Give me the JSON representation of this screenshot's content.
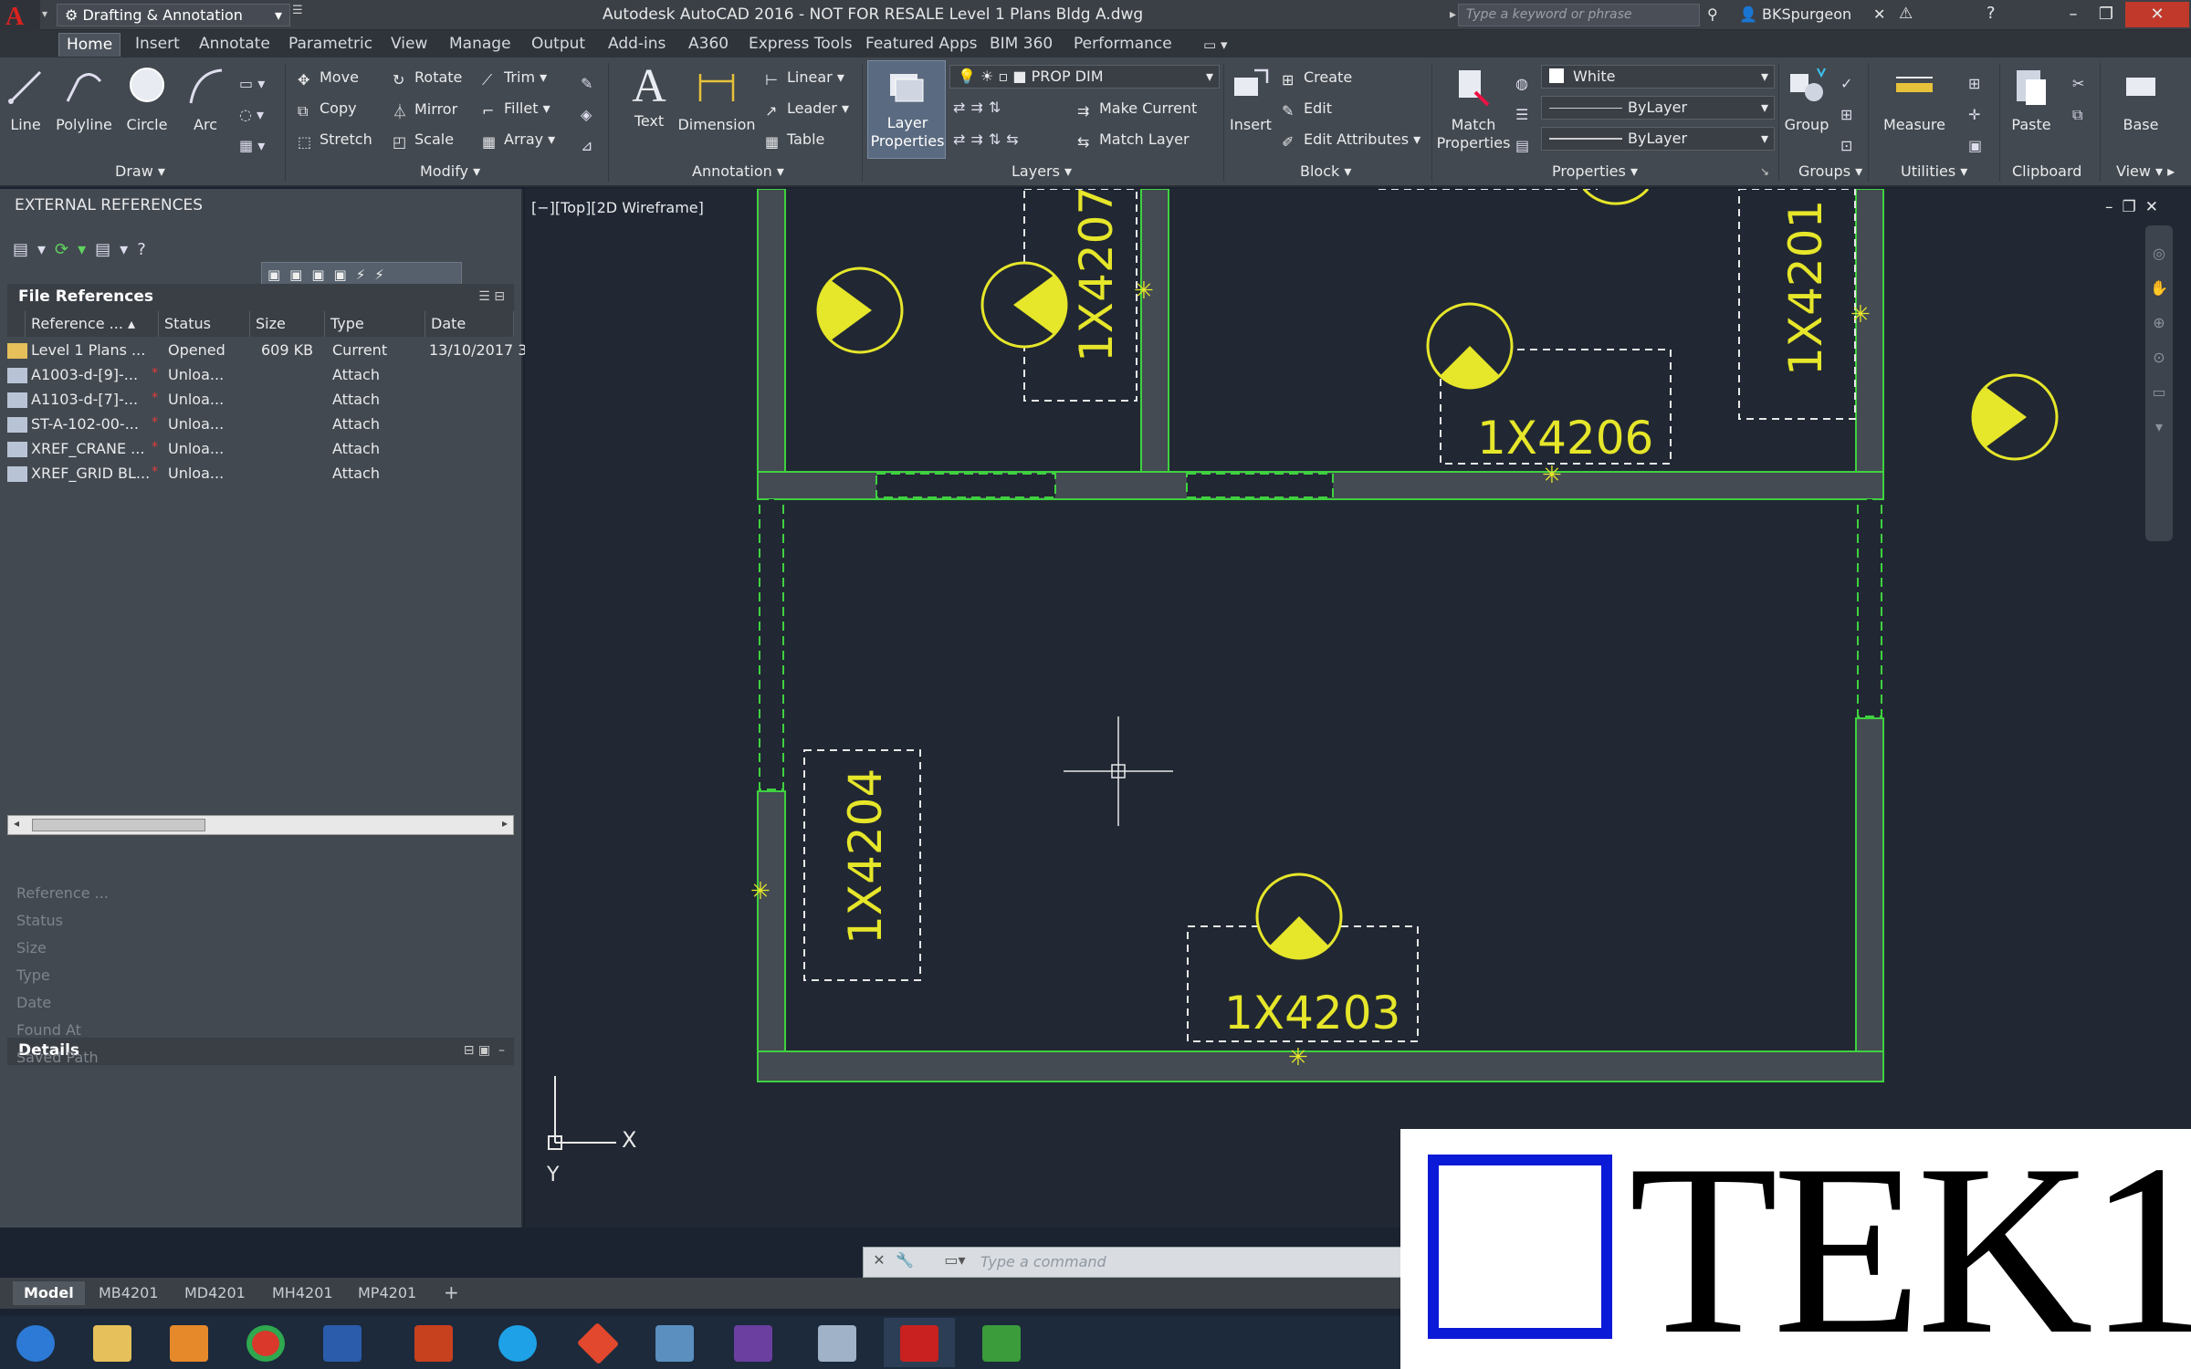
{
  "titlebar": {
    "title": "Autodesk AutoCAD 2016 - NOT FOR RESALE   Level 1 Plans Bldg A.dwg",
    "workspace": "Drafting & Annotation",
    "search_placeholder": "Type a keyword or phrase",
    "user": "BKSpurgeon"
  },
  "ribbon_tabs": [
    "Home",
    "Insert",
    "Annotate",
    "Parametric",
    "View",
    "Manage",
    "Output",
    "Add-ins",
    "A360",
    "Express Tools",
    "Featured Apps",
    "BIM 360",
    "Performance"
  ],
  "ribbon": {
    "draw": {
      "line": "Line",
      "polyline": "Polyline",
      "circle": "Circle",
      "arc": "Arc",
      "label": "Draw"
    },
    "modify": {
      "move": "Move",
      "rotate": "Rotate",
      "trim": "Trim",
      "copy": "Copy",
      "mirror": "Mirror",
      "fillet": "Fillet",
      "stretch": "Stretch",
      "scale": "Scale",
      "array": "Array",
      "label": "Modify"
    },
    "annotation": {
      "text": "Text",
      "dimension": "Dimension",
      "linear": "Linear",
      "leader": "Leader",
      "table": "Table",
      "label": "Annotation"
    },
    "layers": {
      "layer_properties_1": "Layer",
      "layer_properties_2": "Properties",
      "current_layer": "PROP DIM",
      "make_current": "Make Current",
      "match_layer": "Match Layer",
      "label": "Layers"
    },
    "block": {
      "insert": "Insert",
      "create": "Create",
      "edit": "Edit",
      "edit_attributes": "Edit Attributes",
      "label": "Block"
    },
    "properties": {
      "match_1": "Match",
      "match_2": "Properties",
      "color": "White",
      "linetype": "ByLayer",
      "lineweight": "ByLayer",
      "label": "Properties"
    },
    "groups": {
      "group": "Group",
      "label": "Groups"
    },
    "utilities": {
      "measure": "Measure",
      "label": "Utilities"
    },
    "clipboard": {
      "paste": "Paste",
      "label": "Clipboard"
    },
    "view": {
      "base": "Base",
      "label": "View"
    }
  },
  "xref_palette": {
    "title": "EXTERNAL REFERENCES",
    "file_refs_title": "File References",
    "columns": [
      "Reference ...",
      "Status",
      "Size",
      "Type",
      "Date"
    ],
    "rows": [
      {
        "name": "Level 1 Plans ...",
        "status": "Opened",
        "size": "609 KB",
        "type": "Current",
        "date": "13/10/2017 3",
        "flag": ""
      },
      {
        "name": "A1003-d-[9]-...",
        "status": "Unloa...",
        "size": "",
        "type": "Attach",
        "date": "",
        "flag": "*"
      },
      {
        "name": "A1103-d-[7]-...",
        "status": "Unloa...",
        "size": "",
        "type": "Attach",
        "date": "",
        "flag": "*"
      },
      {
        "name": "ST-A-102-00-...",
        "status": "Unloa...",
        "size": "",
        "type": "Attach",
        "date": "",
        "flag": "*"
      },
      {
        "name": "XREF_CRANE ...",
        "status": "Unloa...",
        "size": "",
        "type": "Attach",
        "date": "",
        "flag": "*"
      },
      {
        "name": "XREF_GRID BL...",
        "status": "Unloa...",
        "size": "",
        "type": "Attach",
        "date": "",
        "flag": "*"
      }
    ],
    "details_title": "Details",
    "details_fields": [
      "Reference ...",
      "Status",
      "Size",
      "Type",
      "Date",
      "Found At",
      "Saved Path"
    ]
  },
  "viewport": {
    "controls": "[−][Top][2D Wireframe]",
    "tags": [
      "1X4207",
      "1X4206",
      "1X4201",
      "1X4204",
      "1X4203"
    ],
    "axis_x": "X",
    "axis_y": "Y"
  },
  "command_line": {
    "placeholder": "Type  a  command"
  },
  "layout_tabs": [
    "Model",
    "MB4201",
    "MD4201",
    "MH4201",
    "MP4201"
  ],
  "watermark": {
    "text": "TEK1"
  },
  "colors": {
    "wall": "#3fd13f",
    "tag": "#e6e62a",
    "background": "#212833",
    "watermark_box": "#0a1ad6"
  }
}
